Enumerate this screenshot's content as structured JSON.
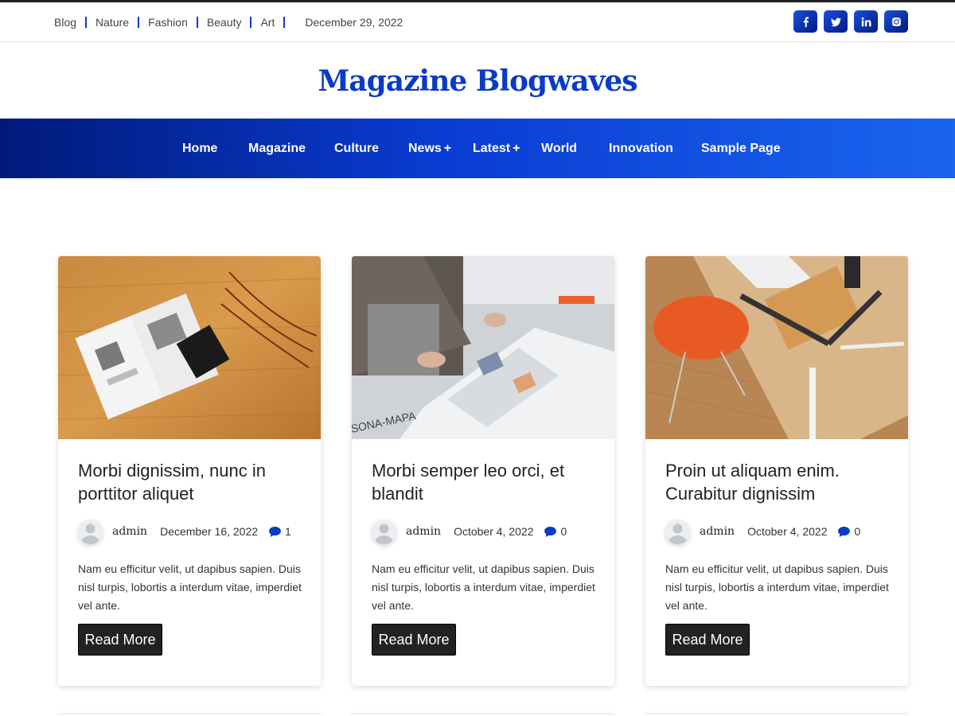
{
  "topbar": {
    "links": [
      "Blog",
      "Nature",
      "Fashion",
      "Beauty",
      "Art"
    ],
    "date": "December 29, 2022",
    "social": [
      {
        "name": "facebook-icon",
        "glyph": "f"
      },
      {
        "name": "twitter-icon",
        "glyph": "t"
      },
      {
        "name": "linkedin-icon",
        "glyph": "in"
      },
      {
        "name": "instagram-icon",
        "glyph": "ig"
      }
    ]
  },
  "brand": {
    "title": "Magazine Blogwaves"
  },
  "nav": {
    "items": [
      "Home",
      "Magazine",
      "Culture",
      "News",
      "Latest",
      "World",
      "Innovation",
      "Sample Page"
    ],
    "plus": "+"
  },
  "colors": {
    "accent": "#0a3bc7",
    "nav_dark": "#001a7a",
    "nav_light": "#1a64f0",
    "button": "#222222"
  },
  "posts": [
    {
      "title": "Morbi dignissim, nunc in porttitor aliquet",
      "author": "admin",
      "date": "December 16, 2022",
      "comments": "1",
      "excerpt": "Nam eu efficitur velit, ut dapibus sapien. Duis nisl turpis, lobortis a interdum vitae, imperdiet vel ante.",
      "button": "Read More"
    },
    {
      "title": "Morbi semper leo orci, et blandit",
      "author": "admin",
      "date": "October 4, 2022",
      "comments": "0",
      "excerpt": "Nam eu efficitur velit, ut dapibus sapien. Duis nisl turpis, lobortis a interdum vitae, imperdiet vel ante.",
      "button": "Read More"
    },
    {
      "title": "Proin ut aliquam enim. Curabitur dignissim",
      "author": "admin",
      "date": "October 4, 2022",
      "comments": "0",
      "excerpt": "Nam eu efficitur velit, ut dapibus sapien. Duis nisl turpis, lobortis a interdum vitae, imperdiet vel ante.",
      "button": "Read More"
    }
  ]
}
